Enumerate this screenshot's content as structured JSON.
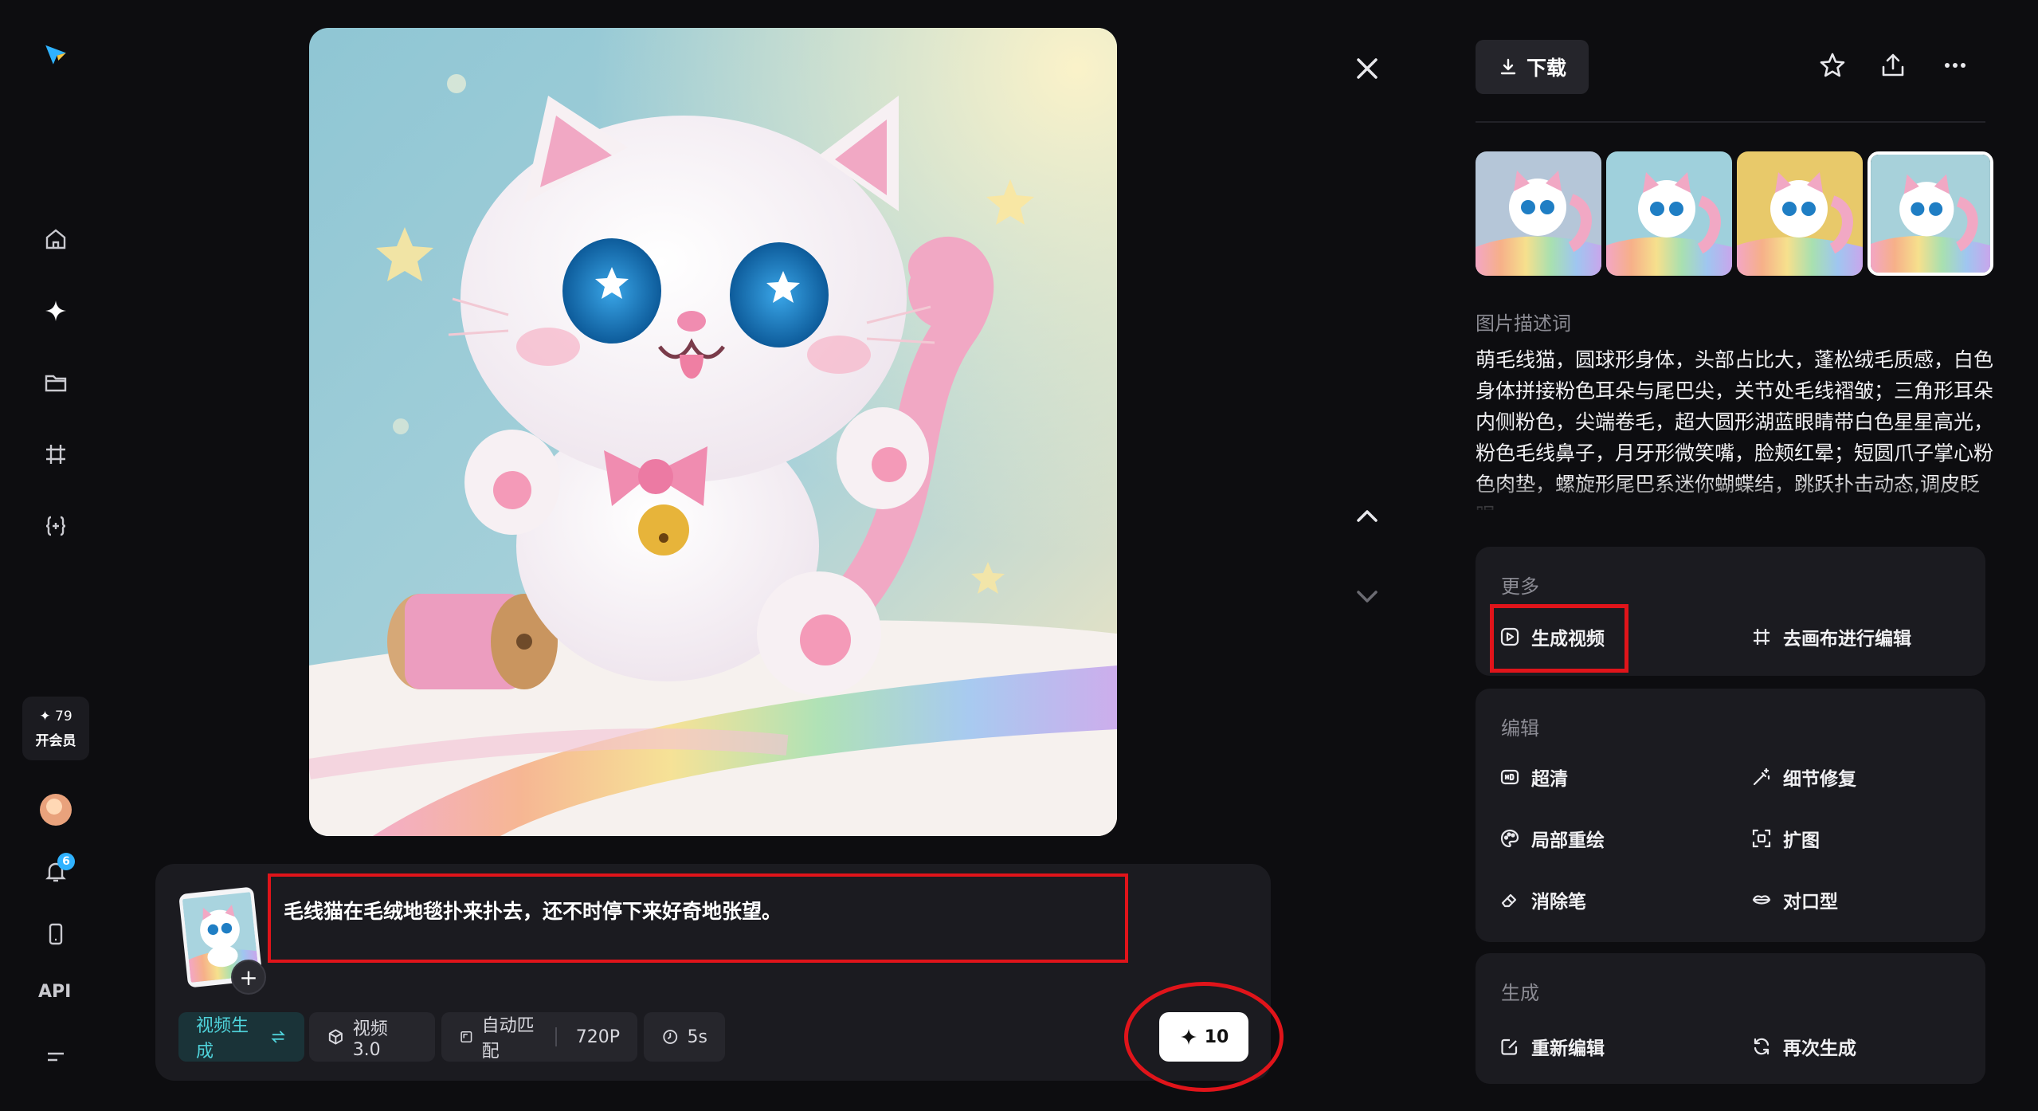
{
  "sidebar": {
    "points": "✦ 79",
    "member_label": "开会员",
    "notification_count": "6",
    "api_label": "API",
    "icons": [
      "logo-icon",
      "home-icon",
      "sparkle-icon",
      "folder-icon",
      "canvas-icon",
      "code-braces-icon",
      "bell-icon",
      "mobile-icon",
      "menu-icon"
    ]
  },
  "prompt": {
    "text": "毛线猫在毛绒地毯扑来扑去，还不时停下来好奇地张望。",
    "mode_label": "视频生成",
    "model_label": "视频 3.0",
    "ratio_label": "自动匹配",
    "resolution_label": "720P",
    "duration_label": "5s",
    "generate_cost": "10"
  },
  "right_panel": {
    "download_label": "下载",
    "description_label": "图片描述词",
    "description": "萌毛线猫，圆球形身体，头部占比大，蓬松绒毛质感，白色身体拼接粉色耳朵与尾巴尖，关节处毛线褶皱；三角形耳朵内侧粉色，尖端卷毛，超大圆形湖蓝眼睛带白色星星高光，粉色毛线鼻子，月牙形微笑嘴，脸颊红晕；短圆爪子掌心粉色肉垫，螺旋形尾巴系迷你蝴蝶结，跳跃扑击动态,调皮眨眼",
    "more": {
      "title": "更多",
      "generate_video": "生成视频",
      "edit_on_canvas": "去画布进行编辑"
    },
    "edit": {
      "title": "编辑",
      "upscale": "超清",
      "detail_fix": "细节修复",
      "inpaint": "局部重绘",
      "expand": "扩图",
      "eraser": "消除笔",
      "lip_sync": "对口型"
    },
    "generate": {
      "title": "生成",
      "re_edit": "重新编辑",
      "regenerate": "再次生成"
    }
  },
  "colors": {
    "background": "#0d0d10",
    "panel": "#1b1b20",
    "accent_teal": "#4fd2da",
    "annotation_red": "#e0141a",
    "badge_blue": "#2fb2ff"
  }
}
